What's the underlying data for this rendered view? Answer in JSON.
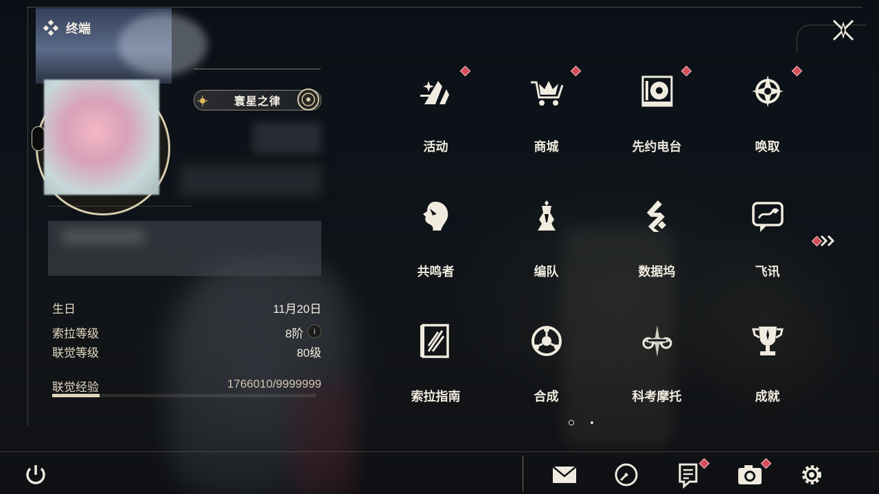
{
  "header": {
    "title": "终端"
  },
  "profile": {
    "title_badge": "寰星之律"
  },
  "stats": {
    "birthday_label": "生日",
    "birthday_value": "11月20日",
    "sola_level_label": "索拉等级",
    "sola_level_value": "8阶",
    "union_level_label": "联觉等级",
    "union_level_value": "80级",
    "union_exp_label": "联觉经验",
    "union_exp_value": "1766010/9999999",
    "union_exp_fraction": 0.18
  },
  "menu": {
    "items": [
      {
        "label": "活动",
        "icon": "events-icon",
        "badge": true
      },
      {
        "label": "商城",
        "icon": "shop-cart-icon",
        "badge": true
      },
      {
        "label": "先约电台",
        "icon": "radio-icon",
        "badge": true
      },
      {
        "label": "唤取",
        "icon": "convene-compass-icon",
        "badge": true
      },
      {
        "label": "共鸣者",
        "icon": "resonator-head-icon",
        "badge": false
      },
      {
        "label": "编队",
        "icon": "team-chess-icon",
        "badge": false
      },
      {
        "label": "数据坞",
        "icon": "data-bank-icon",
        "badge": false
      },
      {
        "label": "飞讯",
        "icon": "chat-message-icon",
        "badge": false
      },
      {
        "label": "索拉指南",
        "icon": "guidebook-icon",
        "badge": false
      },
      {
        "label": "合成",
        "icon": "synthesis-icon",
        "badge": false
      },
      {
        "label": "科考摩托",
        "icon": "motorcycle-icon",
        "badge": false
      },
      {
        "label": "成就",
        "icon": "trophy-icon",
        "badge": false
      }
    ],
    "next_page_badge": true
  },
  "pager": {
    "current": 1,
    "total": 2
  },
  "bottom_bar": {
    "buttons": [
      {
        "icon": "mail-icon",
        "badge": false
      },
      {
        "icon": "clock-icon",
        "badge": false
      },
      {
        "icon": "notes-icon",
        "badge": true
      },
      {
        "icon": "camera-icon",
        "badge": true
      },
      {
        "icon": "settings-gear-icon",
        "badge": false
      }
    ]
  },
  "colors": {
    "accent_gold": "#dfd5b8",
    "badge_red": "#d44e5a",
    "text_main": "#f0ebdf"
  }
}
